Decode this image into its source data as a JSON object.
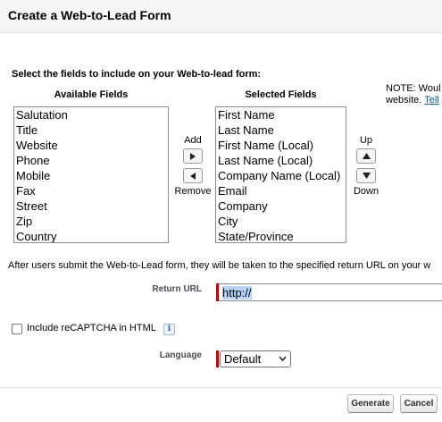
{
  "header": {
    "title": "Create a Web-to-Lead Form"
  },
  "field_selection": {
    "instruction": "Select the fields to include on your Web-to-lead form:",
    "available_heading": "Available Fields",
    "selected_heading": "Selected Fields",
    "available": [
      "Salutation",
      "Title",
      "Website",
      "Phone",
      "Mobile",
      "Fax",
      "Street",
      "Zip",
      "Country"
    ],
    "selected": [
      "First Name",
      "Last Name",
      "First Name (Local)",
      "Last Name (Local)",
      "Company Name (Local)",
      "Email",
      "Company",
      "City",
      "State/Province"
    ],
    "add_label": "Add",
    "remove_label": "Remove",
    "up_label": "Up",
    "down_label": "Down",
    "note_line1": "NOTE: Woul",
    "note_line2": "website.",
    "note_link": "Tell"
  },
  "return_url": {
    "description": "After users submit the Web-to-Lead form, they will be taken to the specified return URL on your w",
    "label": "Return URL",
    "value": "http://"
  },
  "captcha": {
    "label": "Include reCAPTCHA in HTML",
    "checked": false,
    "info_icon": "i"
  },
  "language": {
    "label": "Language",
    "selected": "Default"
  },
  "actions": {
    "generate": "Generate",
    "cancel": "Cancel"
  },
  "colors": {
    "required_bar": "#cc0000",
    "link": "#015ba7",
    "header_bg": "#f6f6f6"
  }
}
